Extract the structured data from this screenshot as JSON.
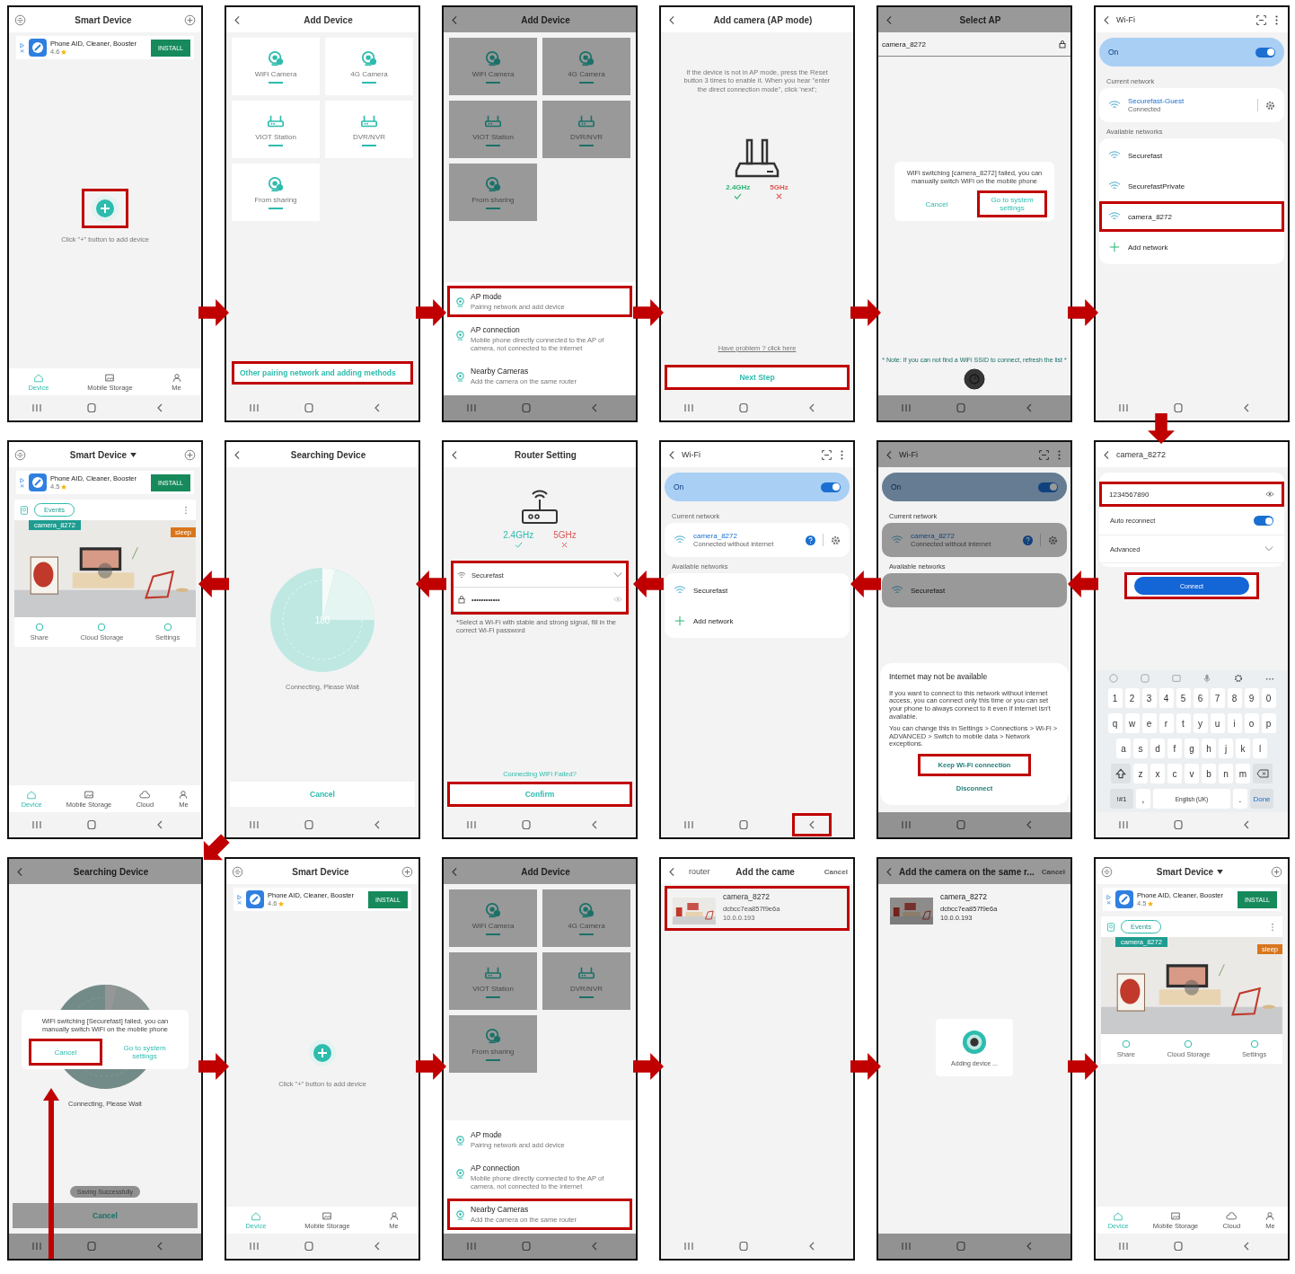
{
  "screens": [
    {
      "kind": "home_empty",
      "title": "Smart Device",
      "ad": {
        "app": "Phone AID, Cleaner, Booster",
        "rating": "4.6",
        "button": "INSTALL"
      },
      "add_highlighted": true,
      "hint": "Click \"+\" button to add device",
      "tabs": [
        {
          "label": "Device",
          "selected": true
        },
        {
          "label": "Mobile Storage",
          "selected": false
        },
        {
          "label": "Me",
          "selected": false
        }
      ],
      "arrow": {
        "kind": "right"
      }
    },
    {
      "kind": "add_device",
      "title": "Add Device",
      "dimmed": false,
      "tiles": [
        {
          "label": "WiFi Camera"
        },
        {
          "label": "4G Camera"
        },
        {
          "label": "VIOT Station"
        },
        {
          "label": "DVR/NVR"
        },
        {
          "label": "From sharing"
        }
      ],
      "link": {
        "text": "Other pairing network and adding methods",
        "highlighted": true
      },
      "arrow": {
        "kind": "right"
      }
    },
    {
      "kind": "add_device",
      "title": "Add Device",
      "dimmed": true,
      "tiles": [
        {
          "label": "WiFi Camera"
        },
        {
          "label": "4G Camera"
        },
        {
          "label": "VIOT Station"
        },
        {
          "label": "DVR/NVR"
        },
        {
          "label": "From sharing"
        }
      ],
      "sheet": [
        {
          "title": "AP mode",
          "desc": "Pairing network and add device",
          "highlighted": true
        },
        {
          "title": "AP connection",
          "desc": "Mobile phone directly connected to the AP of camera, not connected to the internet",
          "highlighted": false
        },
        {
          "title": "Nearby Cameras",
          "desc": "Add the camera on the same router",
          "highlighted": false
        }
      ],
      "arrow": {
        "kind": "right"
      }
    },
    {
      "kind": "ap_guide",
      "title": "Add camera (AP mode)",
      "text": "If the device is not in AP mode, press the Reset button 3 times to enable it. When you hear \"enter the direct connection mode\", click 'next';",
      "bands": [
        {
          "label": "2.4GHz",
          "supported": true
        },
        {
          "label": "5GHz",
          "supported": false
        }
      ],
      "help": "Have problem ? click here",
      "button": {
        "label": "Next Step",
        "highlighted": true
      },
      "arrow": {
        "kind": "right"
      }
    },
    {
      "kind": "select_ap",
      "title": "Select AP",
      "dimmed": true,
      "network": "camera_8272",
      "dialog": {
        "message": "WiFi switching [camera_8272] failed, you can manually switch WiFi on the mobile phone",
        "buttons": [
          {
            "label": "Cancel",
            "highlighted": false
          },
          {
            "label": "Go to system settings",
            "highlighted": true
          }
        ]
      },
      "note": "* Note: If you can not find a WiFi SSID to connect, refresh the list *",
      "arrow": {
        "kind": "right"
      }
    },
    {
      "kind": "wifi",
      "title": "Wi-Fi",
      "dimmed": false,
      "toggle": {
        "label": "On",
        "on": true
      },
      "current_label": "Current network",
      "current": {
        "name": "Securefast-Guest",
        "status": "Connected",
        "help": false
      },
      "available_label": "Available networks",
      "networks": [
        {
          "name": "Securefast",
          "highlighted": false
        },
        {
          "name": "SecurefastPrivate",
          "highlighted": false
        },
        {
          "name": "camera_8272",
          "highlighted": true
        }
      ],
      "add_network": "Add network",
      "back_highlighted": false,
      "arrow": {
        "kind": "down"
      }
    },
    {
      "kind": "home_camera",
      "title": "Smart Device",
      "ad": {
        "app": "Phone AID, Cleaner, Booster",
        "rating": "4.5",
        "button": "INSTALL"
      },
      "events": "Events",
      "camera": {
        "name": "camera_8272",
        "tag": "sleep"
      },
      "actions": [
        "Share",
        "Cloud Storage",
        "Settings"
      ],
      "tabs": [
        {
          "label": "Device",
          "selected": true
        },
        {
          "label": "Mobile Storage",
          "selected": false
        },
        {
          "label": "Cloud",
          "selected": false
        },
        {
          "label": "Me",
          "selected": false
        }
      ],
      "arrow": {
        "kind": "down-left"
      }
    },
    {
      "kind": "searching",
      "title": "Searching Device",
      "dimmed": false,
      "countdown": "180",
      "status": "Connecting, Please Wait",
      "cancel": "Cancel",
      "pointer": false,
      "arrow": {
        "kind": "left"
      }
    },
    {
      "kind": "router",
      "title": "Router Setting",
      "bands": [
        {
          "label": "2.4GHz",
          "supported": true
        },
        {
          "label": "5GHz",
          "supported": false
        }
      ],
      "ssid": "Securefast",
      "password": "••••••••••••",
      "fields_highlighted": true,
      "hint": "*Select a Wi-Fi with stable and strong signal, fill in the correct Wi-Fi password",
      "failed": "Connecting WiFi Failed?",
      "button": {
        "label": "Confirm",
        "highlighted": true
      },
      "arrow": {
        "kind": "left"
      }
    },
    {
      "kind": "wifi",
      "title": "Wi-Fi",
      "dimmed": false,
      "toggle": {
        "label": "On",
        "on": true
      },
      "current_label": "Current network",
      "current": {
        "name": "camera_8272",
        "status": "Connected without internet",
        "help": true
      },
      "available_label": "Available networks",
      "networks": [
        {
          "name": "Securefast",
          "highlighted": false
        }
      ],
      "add_network": "Add network",
      "back_highlighted": true,
      "arrow": {
        "kind": "left"
      }
    },
    {
      "kind": "wifi",
      "title": "Wi-Fi",
      "dimmed": true,
      "toggle": {
        "label": "On",
        "on": true
      },
      "current_label": "Current network",
      "current": {
        "name": "camera_8272",
        "status": "Connected without internet",
        "help": true
      },
      "available_label": "Available networks",
      "networks": [
        {
          "name": "Securefast",
          "highlighted": false
        }
      ],
      "back_highlighted": false,
      "dialog": {
        "title": "Internet may not be available",
        "paragraphs": [
          "If you want to connect to this network without internet access, you can connect only this time or you can set your phone to always connect to it even if internet isn't available.",
          "You can change this in Settings > Connections > Wi-Fi > ADVANCED > Switch to mobile data > Network exceptions."
        ],
        "buttons": [
          {
            "label": "Keep Wi-Fi connection",
            "highlighted": true
          },
          {
            "label": "Disconnect",
            "highlighted": false
          }
        ]
      },
      "arrow": {
        "kind": "left"
      }
    },
    {
      "kind": "wifi_password",
      "title": "camera_8272",
      "password": "1234567890",
      "password_highlighted": true,
      "auto_reconnect": {
        "label": "Auto reconnect",
        "on": true
      },
      "advanced": "Advanced",
      "button": {
        "label": "Connect",
        "highlighted": true
      },
      "keyboard": {
        "rows": [
          [
            "1",
            "2",
            "3",
            "4",
            "5",
            "6",
            "7",
            "8",
            "9",
            "0"
          ],
          [
            "q",
            "w",
            "e",
            "r",
            "t",
            "y",
            "u",
            "i",
            "o",
            "p"
          ],
          [
            "a",
            "s",
            "d",
            "f",
            "g",
            "h",
            "j",
            "k",
            "l"
          ],
          [
            "z",
            "x",
            "c",
            "v",
            "b",
            "n",
            "m"
          ]
        ],
        "symbols": "!#1",
        "comma": ",",
        "space": "English (UK)",
        "period": ".",
        "done": "Done"
      },
      "arrow": {
        "kind": "left"
      }
    },
    {
      "kind": "searching",
      "title": "Searching Device",
      "dimmed": true,
      "status": "Connecting, Please Wait",
      "toast": "Saving Successfully",
      "cancel": "Cancel",
      "pointer": true,
      "dialog": {
        "message": "WiFi switching [Securefast] failed, you can manually switch WiFi on the mobile phone",
        "buttons": [
          {
            "label": "Cancel",
            "highlighted": true
          },
          {
            "label": "Go to system settings",
            "highlighted": false
          }
        ]
      },
      "arrow": {
        "kind": "right"
      }
    },
    {
      "kind": "home_empty",
      "title": "Smart Device",
      "ad": {
        "app": "Phone AID, Cleaner, Booster",
        "rating": "4.6",
        "button": "INSTALL"
      },
      "add_highlighted": false,
      "hint": "Click \"+\" button to add device",
      "tabs": [
        {
          "label": "Device",
          "selected": true
        },
        {
          "label": "Mobile Storage",
          "selected": false
        },
        {
          "label": "Me",
          "selected": false
        }
      ],
      "arrow": {
        "kind": "right"
      }
    },
    {
      "kind": "add_device",
      "title": "Add Device",
      "dimmed": true,
      "tiles": [
        {
          "label": "WiFi Camera"
        },
        {
          "label": "4G Camera"
        },
        {
          "label": "VIOT Station"
        },
        {
          "label": "DVR/NVR"
        },
        {
          "label": "From sharing"
        }
      ],
      "sheet": [
        {
          "title": "AP mode",
          "desc": "Pairing network and add device",
          "highlighted": false
        },
        {
          "title": "AP connection",
          "desc": "Mobile phone directly connected to the AP of camera, not connected to the internet",
          "highlighted": false
        },
        {
          "title": "Nearby Cameras",
          "desc": "Add the camera on the same router",
          "highlighted": true
        }
      ],
      "arrow": {
        "kind": "right"
      }
    },
    {
      "kind": "nearby",
      "dimmed": false,
      "header_left": "router",
      "title": "Add the came",
      "cancel": "Cancel",
      "devices": [
        {
          "name": "camera_8272",
          "id": "dcbcc7ea857f9e6a",
          "ip": "10.0.0.193",
          "highlighted": true
        }
      ],
      "arrow": {
        "kind": "right"
      }
    },
    {
      "kind": "nearby",
      "dimmed": true,
      "title": "Add the camera on the same r...",
      "cancel": "Cancel",
      "devices": [
        {
          "name": "camera_8272",
          "id": "dcbcc7ea857f9e6a",
          "ip": "10.0.0.193",
          "highlighted": false
        }
      ],
      "adding": "Adding device ...",
      "arrow": {
        "kind": "right"
      }
    },
    {
      "kind": "home_camera",
      "title": "Smart Device",
      "ad": {
        "app": "Phone AID, Cleaner, Booster",
        "rating": "4.5",
        "button": "INSTALL"
      },
      "events": "Events",
      "camera": {
        "name": "camera_8272",
        "tag": "sleep"
      },
      "actions": [
        "Share",
        "Cloud Storage",
        "Settings"
      ],
      "tabs": [
        {
          "label": "Device",
          "selected": true
        },
        {
          "label": "Mobile Storage",
          "selected": false
        },
        {
          "label": "Cloud",
          "selected": false
        },
        {
          "label": "Me",
          "selected": false
        }
      ]
    }
  ]
}
